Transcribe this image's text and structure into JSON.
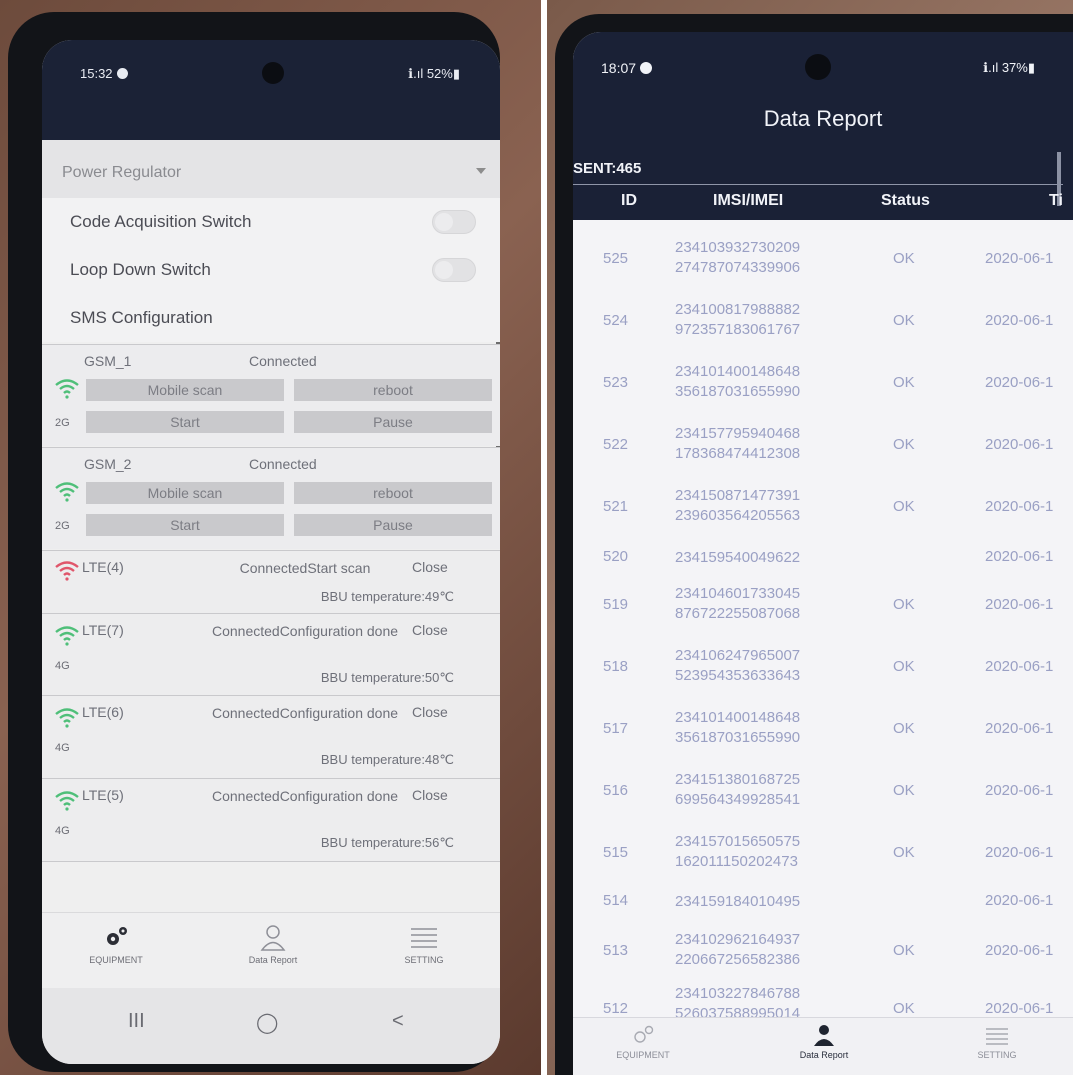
{
  "left_screen": {
    "status_bar": {
      "time": "15:32",
      "signal_battery": "ℹ︎.ıl 52%▮"
    },
    "dropdown": {
      "label": "Power Regulator"
    },
    "settings": [
      {
        "label": "Code Acquisition Switch"
      },
      {
        "label": "Loop Down Switch"
      },
      {
        "label": "SMS Configuration"
      }
    ],
    "gsm": [
      {
        "name": "GSM_1",
        "status": "Connected",
        "band": "2G",
        "mobile_scan": "Mobile scan",
        "reboot": "reboot",
        "start": "Start",
        "pause": "Pause"
      },
      {
        "name": "GSM_2",
        "status": "Connected",
        "band": "2G",
        "mobile_scan": "Mobile scan",
        "reboot": "reboot",
        "start": "Start",
        "pause": "Pause"
      }
    ],
    "lte": [
      {
        "name": "LTE(4)",
        "state": "ConnectedStart scan",
        "close": "Close",
        "temperature": "BBU temperature:49℃",
        "band": "",
        "icon_color": "#e0566b"
      },
      {
        "name": "LTE(7)",
        "state": "ConnectedConfiguration done",
        "close": "Close",
        "temperature": "BBU temperature:50℃",
        "band": "4G",
        "icon_color": "#4fbf79"
      },
      {
        "name": "LTE(6)",
        "state": "ConnectedConfiguration done",
        "close": "Close",
        "temperature": "BBU temperature:48℃",
        "band": "4G",
        "icon_color": "#4fbf79"
      },
      {
        "name": "LTE(5)",
        "state": "ConnectedConfiguration done",
        "close": "Close",
        "temperature": "BBU temperature:56℃",
        "band": "4G",
        "icon_color": "#4fbf79"
      }
    ],
    "bottom_nav": {
      "equipment": "EQUIPMENT",
      "data_report": "Data Report",
      "setting": "SETTING"
    },
    "system_nav": {
      "recents": "III",
      "home": "◯",
      "back": "<"
    }
  },
  "right_screen": {
    "status_bar": {
      "time": "18:07",
      "signal_battery": "ℹ︎.ıl 37%▮"
    },
    "title": "Data Report",
    "sent": "SENT:465",
    "columns": {
      "id": "ID",
      "imsi": "IMSI/IMEI",
      "status": "Status",
      "time": "Ti"
    },
    "rows": [
      {
        "id": "525",
        "imsi": "234103932730209",
        "imei": "274787074339906",
        "status": "OK",
        "time": "2020-06-1"
      },
      {
        "id": "524",
        "imsi": "234100817988882",
        "imei": "972357183061767",
        "status": "OK",
        "time": "2020-06-1"
      },
      {
        "id": "523",
        "imsi": "234101400148648",
        "imei": "356187031655990",
        "status": "OK",
        "time": "2020-06-1"
      },
      {
        "id": "522",
        "imsi": "234157795940468",
        "imei": "178368474412308",
        "status": "OK",
        "time": "2020-06-1"
      },
      {
        "id": "521",
        "imsi": "234150871477391",
        "imei": "239603564205563",
        "status": "OK",
        "time": "2020-06-1"
      },
      {
        "id": "520",
        "imsi": "234159540049622",
        "imei": "",
        "status": "",
        "time": "2020-06-1"
      },
      {
        "id": "519",
        "imsi": "234104601733045",
        "imei": "876722255087068",
        "status": "OK",
        "time": "2020-06-1"
      },
      {
        "id": "518",
        "imsi": "234106247965007",
        "imei": "523954353633643",
        "status": "OK",
        "time": "2020-06-1"
      },
      {
        "id": "517",
        "imsi": "234101400148648",
        "imei": "356187031655990",
        "status": "OK",
        "time": "2020-06-1"
      },
      {
        "id": "516",
        "imsi": "234151380168725",
        "imei": "699564349928541",
        "status": "OK",
        "time": "2020-06-1"
      },
      {
        "id": "515",
        "imsi": "234157015650575",
        "imei": "162011150202473",
        "status": "OK",
        "time": "2020-06-1"
      },
      {
        "id": "514",
        "imsi": "234159184010495",
        "imei": "",
        "status": "",
        "time": "2020-06-1"
      },
      {
        "id": "513",
        "imsi": "234102962164937",
        "imei": "220667256582386",
        "status": "OK",
        "time": "2020-06-1"
      },
      {
        "id": "512",
        "imsi": "234103227846788",
        "imei": "526037588995014",
        "status": "OK",
        "time": "2020-06-1"
      }
    ],
    "bottom_nav": {
      "equipment": "EQUIPMENT",
      "data_report": "Data Report",
      "setting": "SETTING"
    }
  },
  "colors": {
    "header_navy": "#1a2136",
    "table_text": "#9aa0c4",
    "wifi_green": "#4fbf79",
    "wifi_red": "#e0566b"
  }
}
